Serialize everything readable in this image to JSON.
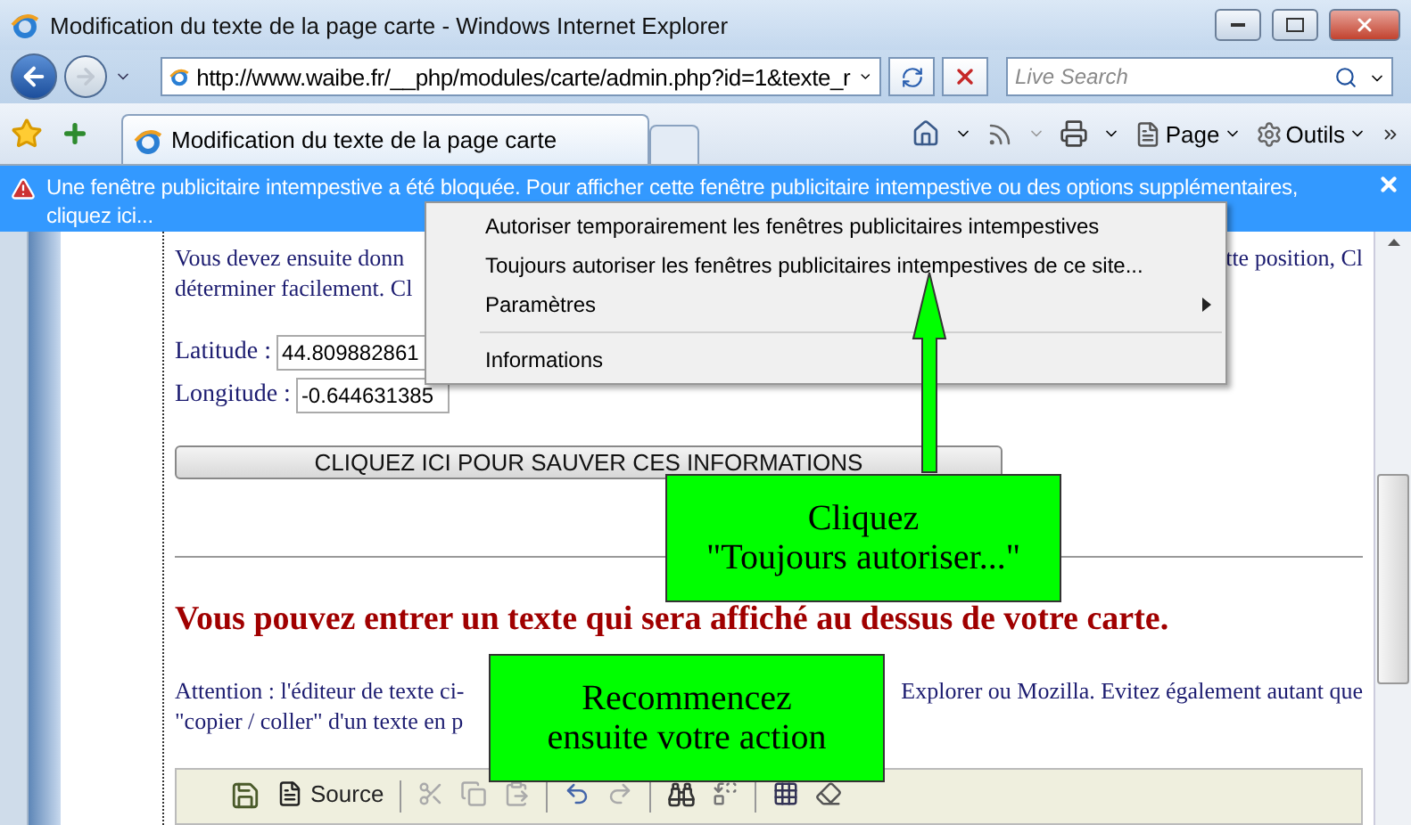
{
  "window": {
    "title": "Modification du texte de la page carte - Windows Internet Explorer"
  },
  "navigation": {
    "address": "http://www.waibe.fr/__php/modules/carte/admin.php?id=1&texte_r",
    "search_placeholder": "Live Search"
  },
  "tabs": [
    {
      "label": "Modification du texte de la page carte",
      "selected": true
    }
  ],
  "command_bar": [
    {
      "label": "Page"
    },
    {
      "label": "Outils"
    }
  ],
  "info_bar": {
    "text": "Une fenêtre publicitaire intempestive a été bloquée. Pour afficher cette fenêtre publicitaire intempestive ou des options supplémentaires, cliquez ici..."
  },
  "context_menu": [
    {
      "kind": "item",
      "label": "Autoriser temporairement les fenêtres publicitaires intempestives"
    },
    {
      "kind": "item",
      "label": "Toujours autoriser les fenêtres publicitaires intempestives de ce site..."
    },
    {
      "kind": "submenu",
      "label": "Paramètres"
    },
    {
      "kind": "separator"
    },
    {
      "kind": "item",
      "label": "Informations"
    }
  ],
  "page": {
    "intro_lines": [
      {
        "left": "Vous devez ensuite donn",
        "right": "tte position, Cl"
      },
      {
        "left": "déterminer facilement. Cl"
      }
    ],
    "fields": [
      {
        "label": "Latitude :",
        "value": "44.809882861"
      },
      {
        "label": "Longitude :",
        "value": "-0.644631385"
      }
    ],
    "save_button": "CLIQUEZ ICI POUR SAUVER CES INFORMATIONS",
    "heading": "Vous pouvez entrer un texte qui sera affiché au dessus de votre carte.",
    "notice_lines": [
      {
        "left": "Attention : l'éditeur de texte ci-",
        "right": "Explorer ou Mozilla. Evitez également autant que"
      },
      {
        "left": "\"copier / coller\" d'un texte en p"
      }
    ],
    "editor_toolbar": {
      "source_label": "Source"
    }
  },
  "callouts": [
    {
      "text": "Cliquez\n\"Toujours autoriser...\""
    },
    {
      "text": "Recommencez\nensuite votre action"
    }
  ]
}
